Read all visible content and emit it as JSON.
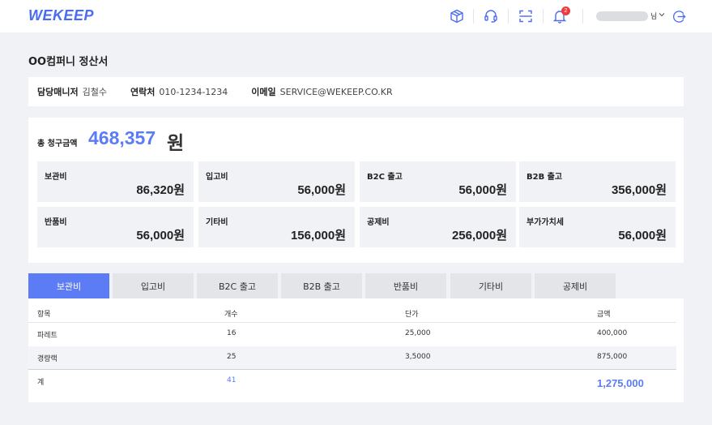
{
  "header": {
    "logo": "WEKEEP",
    "notification_count": "2",
    "user_suffix": "님",
    "icons": [
      "box-icon",
      "headset-icon",
      "scan-icon",
      "bell-icon",
      "chevron-down-icon",
      "logout-icon"
    ]
  },
  "page": {
    "title": "OO컴퍼니 정산서"
  },
  "info": {
    "manager_label": "담당매니저",
    "manager_value": "김철수",
    "contact_label": "연락처",
    "contact_value": "010-1234-1234",
    "email_label": "이메일",
    "email_value": "SERVICE@WEKEEP.CO.KR"
  },
  "summary": {
    "total_label": "총 청구금액",
    "total_value": "468,357",
    "total_unit": "원",
    "stats": [
      {
        "label": "보관비",
        "value": "86,320원"
      },
      {
        "label": "입고비",
        "value": "56,000원"
      },
      {
        "label": "B2C 출고",
        "value": "56,000원"
      },
      {
        "label": "B2B 출고",
        "value": "356,000원"
      },
      {
        "label": "반품비",
        "value": "56,000원"
      },
      {
        "label": "기타비",
        "value": "156,000원"
      },
      {
        "label": "공제비",
        "value": "256,000원"
      },
      {
        "label": "부가가치세",
        "value": "56,000원"
      }
    ]
  },
  "tabs": [
    "보관비",
    "입고비",
    "B2C 출고",
    "B2B 출고",
    "반품비",
    "기타비",
    "공제비"
  ],
  "active_tab": "보관비",
  "table": {
    "headers": [
      "항목",
      "개수",
      "단가",
      "금액"
    ],
    "rows": [
      [
        "파레트",
        "16",
        "25,000",
        "400,000"
      ],
      [
        "경량랙",
        "25",
        "3,5000",
        "875,000"
      ]
    ],
    "total": {
      "label": "계",
      "count": "41",
      "amount": "1,275,000"
    }
  },
  "colors": {
    "accent": "#5b7cf5",
    "logo": "#4a6cf0",
    "badge": "#ef3b3b",
    "page_bg": "#f1f2f6"
  }
}
